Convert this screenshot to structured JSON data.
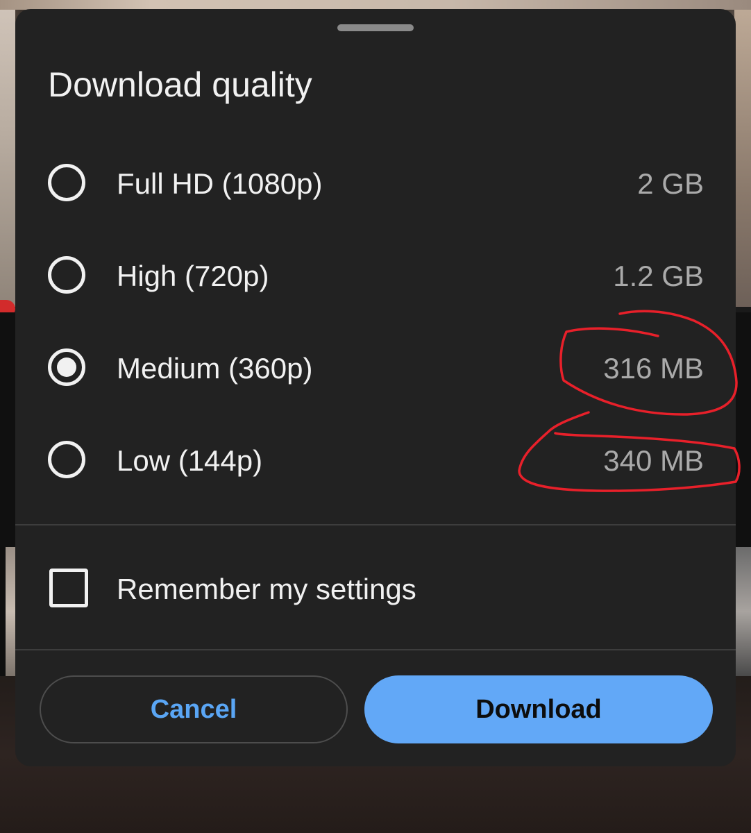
{
  "sheet": {
    "title": "Download quality",
    "options": [
      {
        "label": "Full HD (1080p)",
        "size": "2 GB",
        "selected": false
      },
      {
        "label": "High (720p)",
        "size": "1.2 GB",
        "selected": false
      },
      {
        "label": "Medium (360p)",
        "size": "316 MB",
        "selected": true
      },
      {
        "label": "Low (144p)",
        "size": "340 MB",
        "selected": false
      }
    ],
    "remember_label": "Remember my settings",
    "remember_checked": false,
    "cancel_label": "Cancel",
    "download_label": "Download"
  },
  "colors": {
    "sheet_background": "#222222",
    "accent_blue": "#62a8f7",
    "cancel_text": "#5aa6f5",
    "annotation_red": "#e8202a"
  }
}
